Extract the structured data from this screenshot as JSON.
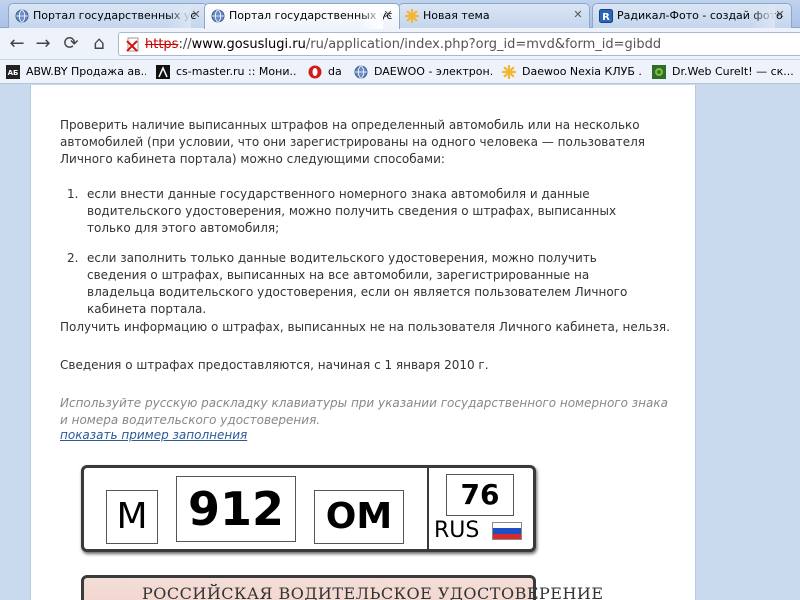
{
  "tabs": [
    {
      "title": "Портал государственных ус",
      "icon": "globe-icon",
      "active": false
    },
    {
      "title": "Портал государственных ус",
      "icon": "globe-icon",
      "active": true
    },
    {
      "title": "Новая тема",
      "icon": "star-flower-icon",
      "active": false
    },
    {
      "title": "Радикал-Фото - создай фото",
      "icon": "radikal-icon",
      "active": false
    }
  ],
  "toolbar": {
    "back": "←",
    "forward": "→",
    "reload": "⟳",
    "home": "⌂",
    "url_scheme": "https",
    "url_sep": "://",
    "url_host": "www.gosuslugi.ru",
    "url_path": "/ru/application/index.php?org_id=mvd&form_id=gibdd"
  },
  "bookmarks": [
    {
      "label": "ABW.BY Продажа ав...",
      "icon": "abw-icon"
    },
    {
      "label": "cs-master.ru :: Мони...",
      "icon": "cs-icon"
    },
    {
      "label": "da",
      "icon": "opera-icon"
    },
    {
      "label": "DAEWOO - электрон...",
      "icon": "globe-icon"
    },
    {
      "label": "Daewoo Nexia КЛУБ ...",
      "icon": "star-flower-icon"
    },
    {
      "label": "Dr.Web CureIt! — ск...",
      "icon": "drweb-icon"
    }
  ],
  "content": {
    "intro": "Проверить наличие выписанных штрафов на определенный автомобиль или на несколько автомобилей (при условии, что они зарегистрированы на одного человека — пользователя Личного кабинета портала) можно следующими способами:",
    "items": [
      {
        "num": "1.",
        "text": "если внести данные государственного номерного знака автомобиля и данные водительского удостоверения, можно получить сведения о штрафах, выписанных только для этого автомобиля;"
      },
      {
        "num": "2.",
        "text": "если заполнить только данные водительского удостоверения, можно получить сведения о штрафах, выписанных на все автомобили, зарегистрированные на владельца водительского удостоверения, если он является пользователем Личного кабинета портала."
      }
    ],
    "note1": "Получить информацию о штрафах, выписанных не на пользователя Личного кабинета, нельзя.",
    "note2": "Сведения о штрафах предоставляются, начиная с 1 января 2010 г.",
    "hint": "Используйте русскую раскладку клавиатуры при указании государственного номерного знака и номера водительского удостоверения.",
    "example_link": "показать пример заполнения"
  },
  "plate": {
    "letter1": "М",
    "number": "912",
    "letters2": "ОМ",
    "region": "76",
    "country": "RUS",
    "flag_colors": [
      "#ffffff",
      "#1f4fc4",
      "#d72b2b"
    ]
  },
  "license": {
    "title": "РОССИЙСКАЯ  ВОДИТЕЛЬСКОЕ УДОСТОВЕРЕНИЕ"
  }
}
